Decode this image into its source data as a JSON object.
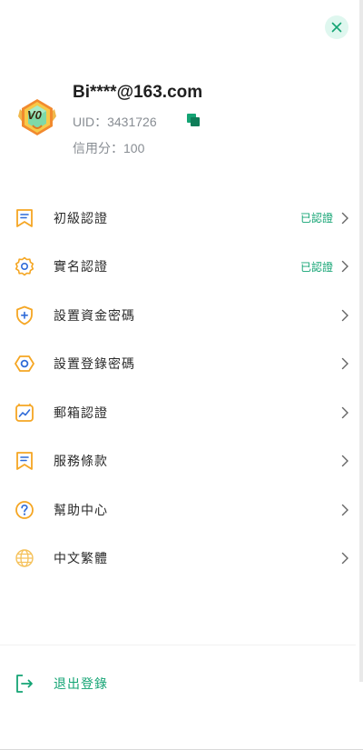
{
  "profile": {
    "email": "Bi****@163.com",
    "uid_label": "UID：3431726",
    "credit_label": "信用分：100",
    "level_badge": "V0"
  },
  "menu": {
    "items": [
      {
        "label": "初級認證",
        "status": "已認證",
        "icon": "bookmark-icon"
      },
      {
        "label": "實名認證",
        "status": "已認證",
        "icon": "badge-icon"
      },
      {
        "label": "設置資金密碼",
        "status": "",
        "icon": "shield-plus-icon"
      },
      {
        "label": "設置登錄密碼",
        "status": "",
        "icon": "hexagon-icon"
      },
      {
        "label": "郵箱認證",
        "status": "",
        "icon": "mailbox-chart-icon"
      },
      {
        "label": "服務條款",
        "status": "",
        "icon": "document-icon"
      },
      {
        "label": "幫助中心",
        "status": "",
        "icon": "question-icon"
      },
      {
        "label": "中文繁體",
        "status": "",
        "icon": "globe-icon"
      }
    ]
  },
  "logout": {
    "label": "退出登錄"
  },
  "colors": {
    "accent": "#14a474",
    "icon_orange": "#f5a623",
    "icon_blue": "#2f6bd8",
    "text_primary": "#1f1f1f",
    "text_secondary": "#888d93"
  }
}
